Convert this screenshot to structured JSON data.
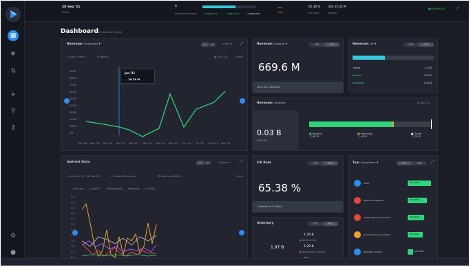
{
  "topbar": {
    "date": "28 Sep '21",
    "date_sub": "Future",
    "kpi_top": "0",
    "kpi_labels": [
      "BOOKINGS/DELIVERED",
      "0.00B/0.43 B",
      "0.00B/0.43 B",
      "7.49B/1.05 B"
    ],
    "rev_label": "REV",
    "gap_label": "GAP",
    "percent": "65.38 %",
    "usd": "US$ 25.45 M",
    "pipeline_label": "FUL GOOD",
    "revenue_label": "REVENUE",
    "live_mode": "LIVE MODE"
  },
  "colors": {
    "accent": "#2f8cf0",
    "green": "#2ed47a",
    "cyan": "#38c8e0"
  },
  "dashboard": {
    "title": "Dashboard",
    "subtitle": "All revenue in USD"
  },
  "revenue_delivered": {
    "header": "Revenue:",
    "header_sub": "Delivered",
    "year_label": "Year",
    "filter_period": "Last 1 Year",
    "filter_group": "None",
    "legend": "2021 Q2",
    "reset": "Reset",
    "tooltip_title": "Jan '21",
    "tooltip_value": "76.28 M",
    "y_ticks": [
      "900M",
      "800M",
      "700M",
      "600M",
      "500M",
      "400M",
      "300M",
      "200M",
      "100M",
      "0M"
    ],
    "x_ticks": [
      "Oct '20",
      "Nov '20",
      "Dec '20",
      "Jan '21",
      "Feb '21",
      "Mar '21",
      "Apr '21",
      "May '21",
      "Jun '21",
      "Jul '21",
      "Aug '21",
      "Sep '21"
    ]
  },
  "revenue_booked": {
    "header": "Revenue:",
    "header_sub": "Booked",
    "toggle": [
      "YTD",
      "MTD"
    ],
    "value": "669.6 M",
    "footer": "28.4 M in pipeline"
  },
  "revenue_all": {
    "header": "Revenue:",
    "header_sub": "All",
    "toggle": [
      "QTD",
      "MTD"
    ],
    "rows": [
      {
        "label": "Target",
        "value": "1.22 B"
      },
      {
        "label": "Booked",
        "value": "0.67 B"
      },
      {
        "label": "Delivered",
        "value": "0.45 B"
      }
    ]
  },
  "revenue_pipeline": {
    "header": "Revenue:",
    "header_sub": "Pipeline",
    "date": "28 Sep '21",
    "value": "0.03 B",
    "value_sub": "PIPELINE",
    "legend": [
      {
        "label": "Booked",
        "value": "0.67 B"
      },
      {
        "label": "Projection",
        "value": "0.48 B"
      },
      {
        "label": "Target",
        "value": "1.22 B"
      }
    ]
  },
  "indirect": {
    "header": "Indirect Data",
    "options": "Options",
    "filter_range": "(01 Sep '21 - 28 Sep '21)",
    "filter_partners": "5 Indirect Partners",
    "filter_metric": "Revenue (USD)",
    "reset": "Reset",
    "legend": [
      "Comcast",
      "AmpliFi",
      "Wordsgoods",
      "Peopleize",
      "In Mobi"
    ],
    "y_ticks": [
      "5.5",
      "5.0",
      "4.5",
      "4.0",
      "3.5",
      "3.0",
      "2.5",
      "2.0",
      "1.5",
      "1.0",
      "0.5",
      "0.0"
    ],
    "x_label": "Sep '21"
  },
  "fill_rate": {
    "header": "Fill Rate",
    "toggle": [
      "YTD",
      "MTD"
    ],
    "value": "65.38 %",
    "footer": "Updated at 4:34pm"
  },
  "inventory": {
    "header": "Inventory",
    "toggle": [
      "YTD",
      "MTD"
    ],
    "value": "1.97 B",
    "items": [
      {
        "value": "1.26 B",
        "label": "IMPRESSIONS"
      },
      {
        "value": "1.29 B",
        "label": "IMPRESSIONS SERVED"
      },
      {
        "value": "0.8",
        "label": "REMAINING"
      }
    ]
  },
  "top_advertiser": {
    "header": "Top:",
    "header_sub": "Advertiser",
    "toggle": [
      "YTD",
      "MTD"
    ],
    "rows": [
      {
        "name": "Intuit",
        "value": "000 000M",
        "color": "#2f8cf0"
      },
      {
        "name": "Peyless Shoesource",
        "value": "000 000M",
        "color": "#e8473c"
      },
      {
        "name": "United Defense Industries",
        "value": "000 000M",
        "color": "#e8473c"
      },
      {
        "name": "Funds Warehouse Limited",
        "value": "000 000M",
        "color": "#f0a030"
      },
      {
        "name": "Web Back Lumber",
        "value": "000 000M",
        "color": "#2f8cf0"
      }
    ],
    "axis": [
      "0M",
      "20M",
      "300M"
    ]
  }
}
